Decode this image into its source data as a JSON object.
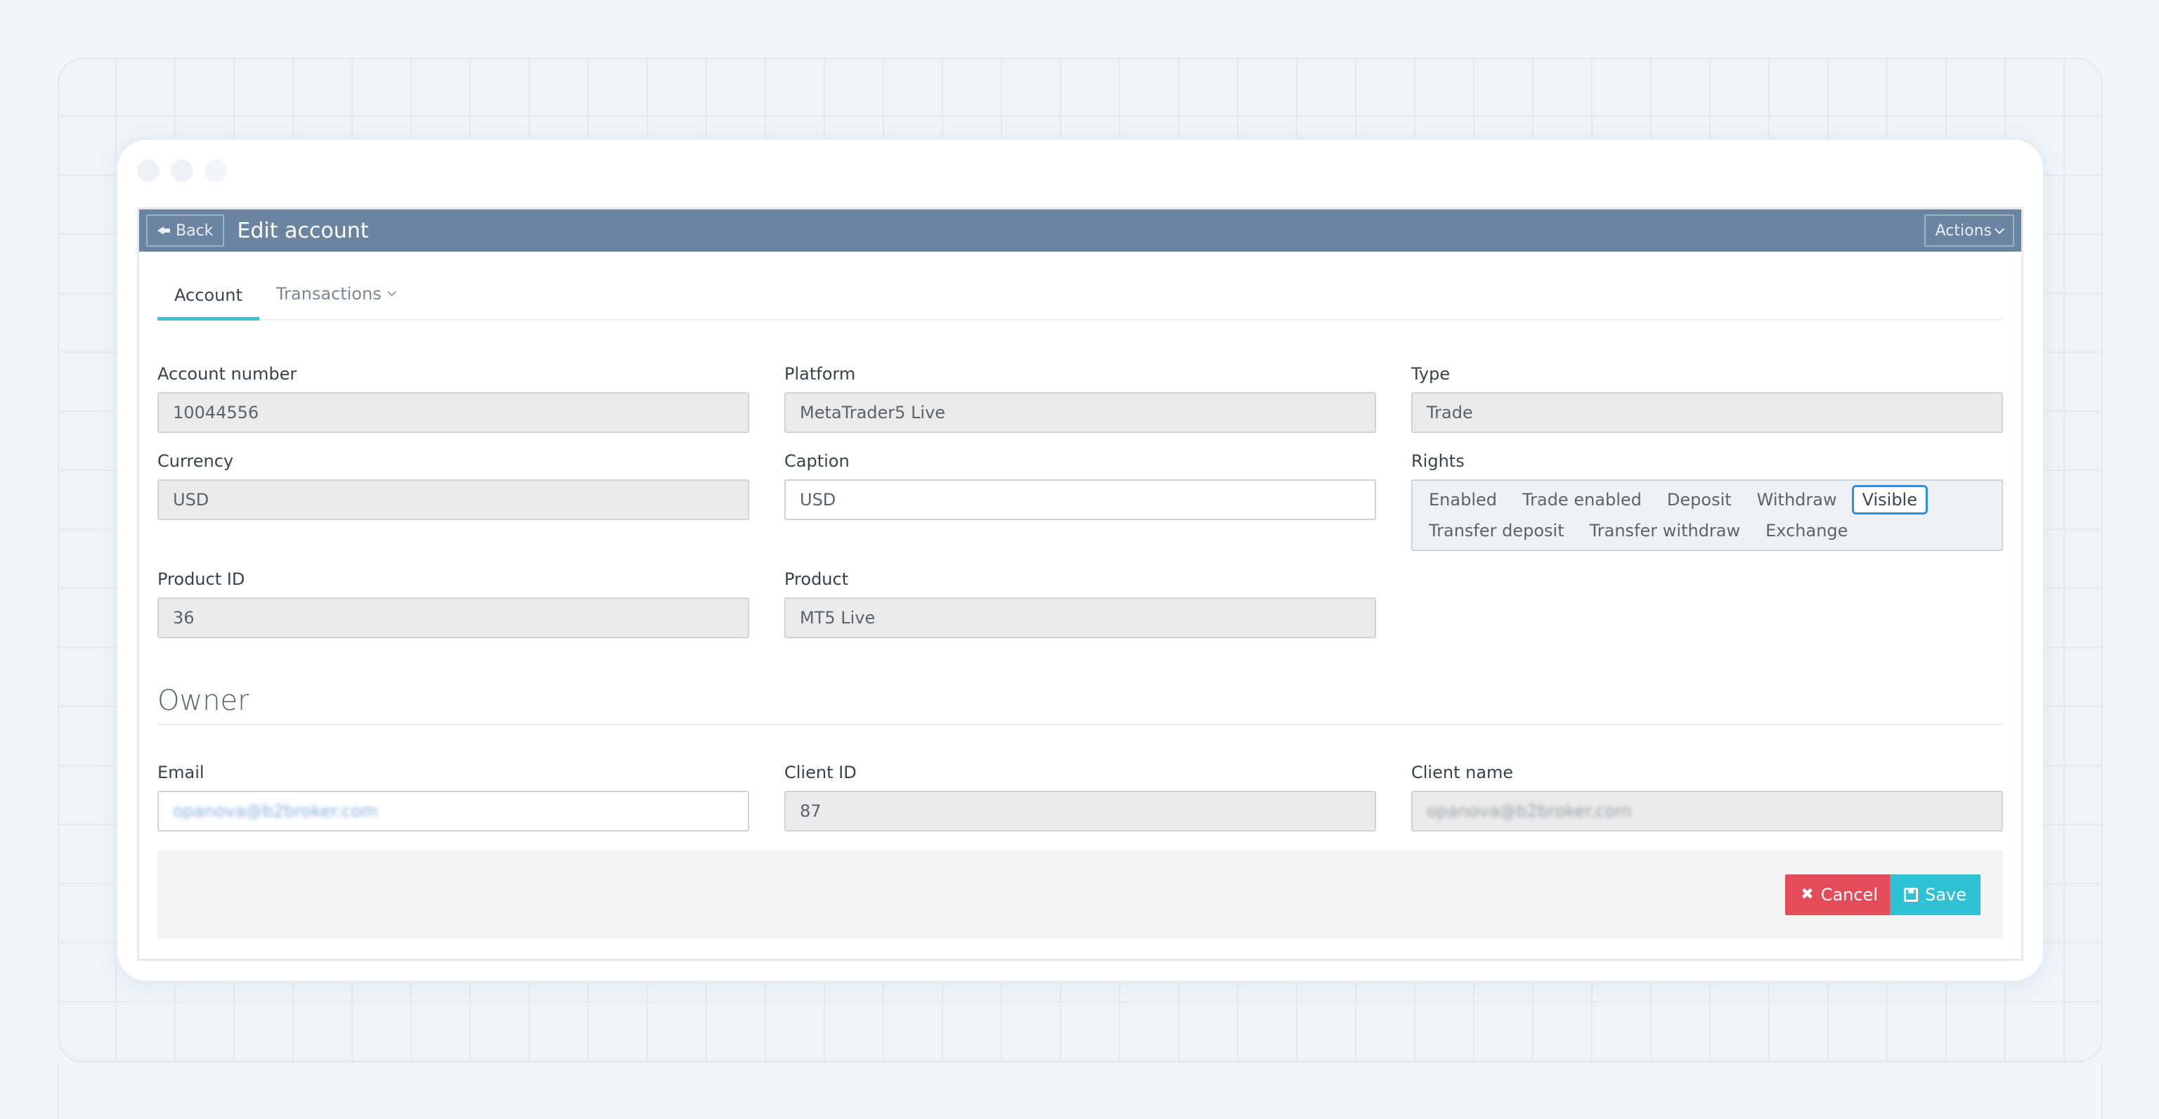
{
  "header": {
    "back_label": "Back",
    "title": "Edit account",
    "actions_label": "Actions"
  },
  "tabs": [
    {
      "label": "Account",
      "active": true
    },
    {
      "label": "Transactions",
      "active": false
    }
  ],
  "account": {
    "account_number": {
      "label": "Account number",
      "value": "10044556"
    },
    "platform": {
      "label": "Platform",
      "value": "MetaTrader5 Live"
    },
    "type": {
      "label": "Type",
      "value": "Trade"
    },
    "currency": {
      "label": "Currency",
      "value": "USD"
    },
    "caption": {
      "label": "Caption",
      "value": "USD"
    },
    "rights": {
      "label": "Rights",
      "items": [
        "Enabled",
        "Trade enabled",
        "Deposit",
        "Withdraw",
        "Visible",
        "Transfer deposit",
        "Transfer withdraw",
        "Exchange"
      ],
      "selected": "Visible"
    },
    "product_id": {
      "label": "Product ID",
      "value": "36"
    },
    "product": {
      "label": "Product",
      "value": "MT5 Live"
    }
  },
  "owner": {
    "section_title": "Owner",
    "email": {
      "label": "Email",
      "value": "opanova@b2broker.com"
    },
    "client_id": {
      "label": "Client ID",
      "value": "87"
    },
    "client_name": {
      "label": "Client name",
      "value": "opanova@b2broker.com"
    }
  },
  "footer": {
    "cancel_label": "Cancel",
    "save_label": "Save"
  },
  "colors": {
    "header_bg": "#6a84a2",
    "tab_accent": "#3cc2cf",
    "cancel": "#e44c5a",
    "save": "#2fc1d4",
    "selected_chip_border": "#2f8fe0"
  }
}
